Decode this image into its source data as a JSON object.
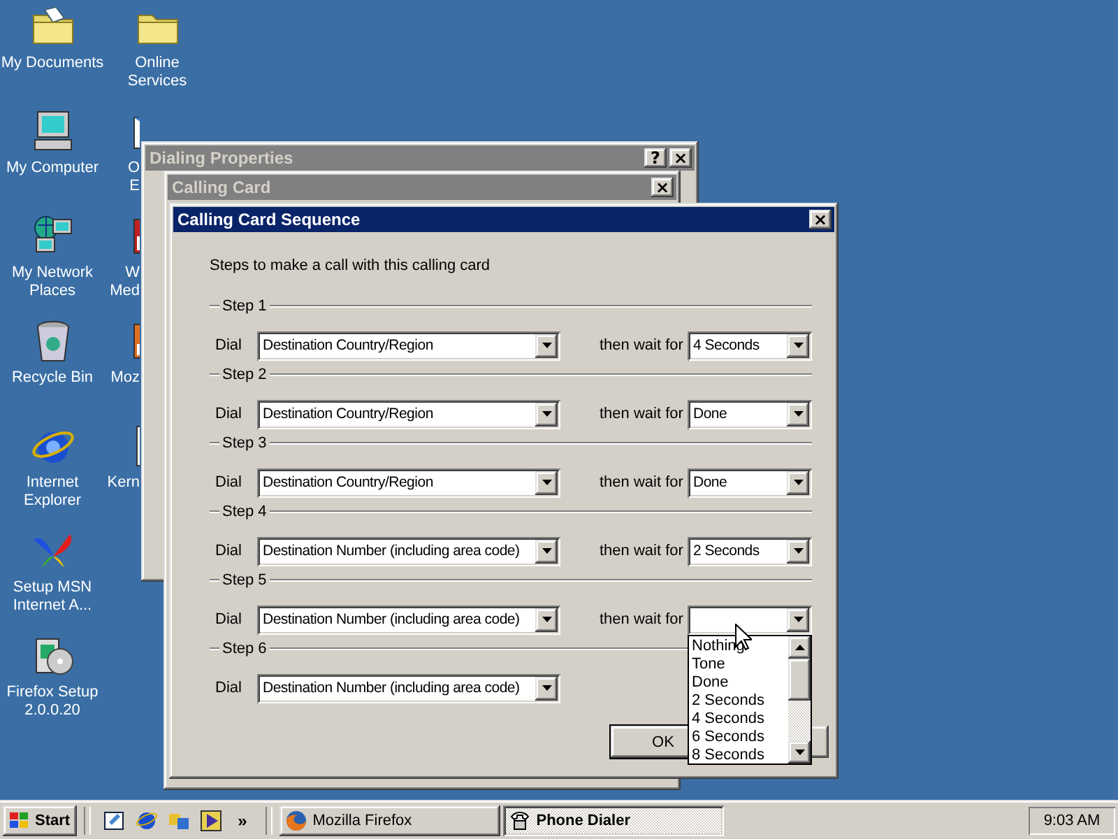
{
  "desktop": {
    "columns": [
      [
        {
          "kind": "documents",
          "lines": [
            "My Documents"
          ],
          "cut": false
        },
        {
          "kind": "computer",
          "lines": [
            "My Computer"
          ],
          "cut": false
        },
        {
          "kind": "network",
          "lines": [
            "My Network",
            "Places"
          ],
          "cut": false
        },
        {
          "kind": "recycle",
          "lines": [
            "Recycle Bin"
          ],
          "cut": false
        },
        {
          "kind": "ie",
          "lines": [
            "Internet",
            "Explorer"
          ],
          "cut": false
        },
        {
          "kind": "msn",
          "lines": [
            "Setup MSN",
            "Internet A..."
          ],
          "cut": false
        },
        {
          "kind": "setup",
          "lines": [
            "Firefox Setup",
            "2.0.0.20"
          ],
          "cut": false
        }
      ],
      [
        {
          "kind": "folder",
          "lines": [
            "Online",
            "Services"
          ],
          "cut": false
        },
        {
          "kind": "mail",
          "lines": [
            "O",
            "E"
          ],
          "cut": true
        },
        {
          "kind": "media",
          "lines": [
            "W",
            "Med"
          ],
          "cut": true
        },
        {
          "kind": "mozilla",
          "lines": [
            "Moz"
          ],
          "cut": true
        },
        {
          "kind": "doc",
          "lines": [
            "Kern"
          ],
          "cut": true
        }
      ]
    ]
  },
  "windows": [
    {
      "title": "Dialing Properties",
      "active": false,
      "title_buttons": [
        "?",
        "×"
      ]
    },
    {
      "title": "Calling Card",
      "active": false,
      "title_buttons": [
        "×"
      ]
    }
  ],
  "dialog": {
    "title": "Calling Card Sequence",
    "active": true,
    "title_buttons": [
      "×"
    ],
    "intro": "Steps to make a call with this calling card",
    "steps": [
      {
        "label": "Step 1",
        "dial_label": "Dial",
        "dial_value": "Destination Country/Region",
        "wait": {
          "label": "then wait for",
          "value": "4 Seconds"
        }
      },
      {
        "label": "Step 2",
        "dial_label": "Dial",
        "dial_value": "Destination Country/Region",
        "wait": {
          "label": "then wait for",
          "value": "Done"
        }
      },
      {
        "label": "Step 3",
        "dial_label": "Dial",
        "dial_value": "Destination Country/Region",
        "wait": {
          "label": "then wait for",
          "value": "Done"
        }
      },
      {
        "label": "Step 4",
        "dial_label": "Dial",
        "dial_value": "Destination Number (including area code)",
        "wait": {
          "label": "then wait for",
          "value": "2 Seconds"
        }
      },
      {
        "label": "Step 5",
        "dial_label": "Dial",
        "dial_value": "Destination Number (including area code)",
        "wait": {
          "label": "then wait for",
          "expanded": true,
          "options": [
            {
              "label": "Nothing",
              "selected": false
            },
            {
              "label": "Tone",
              "selected": false
            },
            {
              "label": "Done",
              "selected": false
            },
            {
              "label": "2 Seconds",
              "selected": false
            },
            {
              "label": "4 Seconds",
              "selected": false
            },
            {
              "label": "6 Seconds",
              "selected": false
            },
            {
              "label": "8 Seconds",
              "selected": false
            }
          ]
        }
      },
      {
        "label": "Step 6",
        "dial_label": "Dial",
        "dial_value": "Destination Number (including area code)"
      }
    ],
    "buttons": [
      {
        "kind": "default",
        "label": "OK"
      },
      {
        "kind": "blank"
      }
    ]
  },
  "taskbar": {
    "start": "Start",
    "quick_launch": [
      {
        "kind": "desktop"
      },
      {
        "kind": "ie"
      },
      {
        "kind": "channels"
      },
      {
        "kind": "media"
      }
    ],
    "overflow": "»",
    "tasks": [
      {
        "label": "Mozilla Firefox",
        "kind": "firefox",
        "selected": false
      },
      {
        "label": "Phone Dialer",
        "kind": "phone",
        "selected": true
      }
    ],
    "clock": "9:03 AM"
  }
}
